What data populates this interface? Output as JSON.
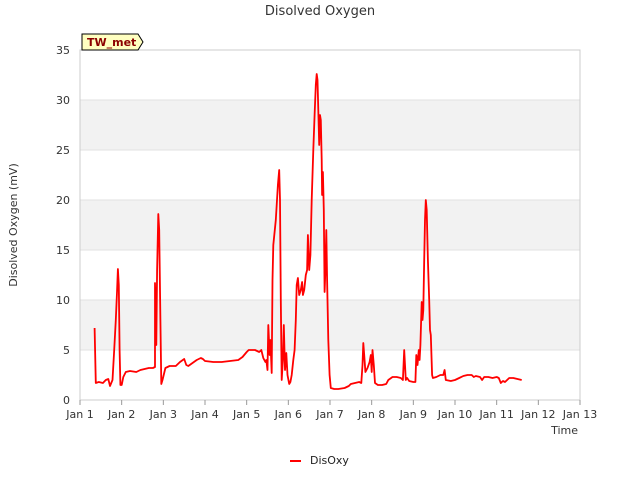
{
  "chart_data": {
    "type": "line",
    "title": "Disolved Oxygen",
    "xlabel": "Time",
    "ylabel": "Disolved Oxygen (mV)",
    "xlim": [
      "Jan 1",
      "Jan 13"
    ],
    "ylim": [
      0,
      35
    ],
    "x_ticks": [
      "Jan 1",
      "Jan 2",
      "Jan 3",
      "Jan 4",
      "Jan 5",
      "Jan 6",
      "Jan 7",
      "Jan 8",
      "Jan 9",
      "Jan 10",
      "Jan 11",
      "Jan 12",
      "Jan 13"
    ],
    "y_ticks": [
      0,
      5,
      10,
      15,
      20,
      25,
      30,
      35
    ],
    "grid": "horizontal bands",
    "legend_position": "bottom-center",
    "station_badge": "TW_met",
    "colors": {
      "series": "#ff0000",
      "band": "#f2f2f2",
      "badge_fill": "#ffffc0"
    },
    "series": [
      {
        "name": "DisOxy",
        "x_unit": "days since Jan 1",
        "points": [
          [
            0.35,
            7.2
          ],
          [
            0.38,
            1.7
          ],
          [
            0.45,
            1.8
          ],
          [
            0.55,
            1.7
          ],
          [
            0.62,
            2.0
          ],
          [
            0.68,
            2.1
          ],
          [
            0.72,
            1.4
          ],
          [
            0.78,
            2.0
          ],
          [
            0.82,
            5.0
          ],
          [
            0.86,
            8.0
          ],
          [
            0.89,
            11.0
          ],
          [
            0.91,
            13.1
          ],
          [
            0.93,
            11.5
          ],
          [
            0.95,
            5.0
          ],
          [
            0.97,
            1.5
          ],
          [
            1.0,
            1.5
          ],
          [
            1.04,
            2.3
          ],
          [
            1.1,
            2.8
          ],
          [
            1.2,
            2.9
          ],
          [
            1.35,
            2.8
          ],
          [
            1.45,
            3.0
          ],
          [
            1.55,
            3.1
          ],
          [
            1.65,
            3.2
          ],
          [
            1.75,
            3.2
          ],
          [
            1.8,
            3.3
          ],
          [
            1.8,
            11.7
          ],
          [
            1.83,
            5.5
          ],
          [
            1.85,
            13.0
          ],
          [
            1.88,
            18.6
          ],
          [
            1.9,
            17.0
          ],
          [
            1.93,
            8.0
          ],
          [
            1.95,
            1.6
          ],
          [
            1.98,
            2.0
          ],
          [
            2.05,
            3.2
          ],
          [
            2.15,
            3.4
          ],
          [
            2.3,
            3.4
          ],
          [
            2.4,
            3.8
          ],
          [
            2.5,
            4.1
          ],
          [
            2.55,
            3.5
          ],
          [
            2.6,
            3.4
          ],
          [
            2.7,
            3.7
          ],
          [
            2.8,
            4.0
          ],
          [
            2.9,
            4.2
          ],
          [
            2.95,
            4.1
          ],
          [
            3.0,
            3.9
          ],
          [
            3.2,
            3.8
          ],
          [
            3.4,
            3.8
          ],
          [
            3.6,
            3.9
          ],
          [
            3.8,
            4.0
          ],
          [
            3.9,
            4.3
          ],
          [
            4.0,
            4.8
          ],
          [
            4.05,
            5.0
          ],
          [
            4.2,
            5.0
          ],
          [
            4.3,
            4.8
          ],
          [
            4.35,
            5.0
          ],
          [
            4.4,
            4.2
          ],
          [
            4.45,
            3.8
          ],
          [
            4.47,
            4.0
          ],
          [
            4.5,
            3.0
          ],
          [
            4.52,
            7.5
          ],
          [
            4.55,
            4.5
          ],
          [
            4.57,
            6.0
          ],
          [
            4.6,
            2.7
          ],
          [
            4.62,
            12.0
          ],
          [
            4.64,
            15.5
          ],
          [
            4.7,
            18.0
          ],
          [
            4.75,
            21.5
          ],
          [
            4.78,
            23.0
          ],
          [
            4.8,
            20.0
          ],
          [
            4.82,
            10.0
          ],
          [
            4.84,
            2.0
          ],
          [
            4.87,
            4.0
          ],
          [
            4.89,
            7.5
          ],
          [
            4.92,
            3.0
          ],
          [
            4.95,
            4.7
          ],
          [
            4.98,
            2.5
          ],
          [
            5.02,
            1.6
          ],
          [
            5.05,
            1.8
          ],
          [
            5.08,
            2.5
          ],
          [
            5.12,
            4.0
          ],
          [
            5.15,
            5.0
          ],
          [
            5.18,
            8.0
          ],
          [
            5.2,
            11.5
          ],
          [
            5.23,
            12.2
          ],
          [
            5.26,
            10.5
          ],
          [
            5.3,
            11.0
          ],
          [
            5.33,
            11.8
          ],
          [
            5.35,
            10.5
          ],
          [
            5.38,
            11.0
          ],
          [
            5.42,
            12.5
          ],
          [
            5.45,
            13.0
          ],
          [
            5.47,
            16.5
          ],
          [
            5.5,
            13.0
          ],
          [
            5.53,
            14.5
          ],
          [
            5.56,
            20.0
          ],
          [
            5.6,
            25.0
          ],
          [
            5.63,
            28.5
          ],
          [
            5.66,
            31.5
          ],
          [
            5.68,
            32.6
          ],
          [
            5.7,
            32.0
          ],
          [
            5.72,
            29.0
          ],
          [
            5.74,
            25.5
          ],
          [
            5.76,
            28.5
          ],
          [
            5.78,
            28.0
          ],
          [
            5.8,
            24.0
          ],
          [
            5.81,
            20.5
          ],
          [
            5.83,
            22.8
          ],
          [
            5.85,
            19.0
          ],
          [
            5.87,
            10.8
          ],
          [
            5.89,
            13.0
          ],
          [
            5.91,
            17.0
          ],
          [
            5.93,
            12.0
          ],
          [
            5.96,
            6.0
          ],
          [
            5.99,
            2.5
          ],
          [
            6.02,
            1.2
          ],
          [
            6.1,
            1.1
          ],
          [
            6.2,
            1.1
          ],
          [
            6.35,
            1.2
          ],
          [
            6.45,
            1.4
          ],
          [
            6.5,
            1.6
          ],
          [
            6.6,
            1.7
          ],
          [
            6.7,
            1.8
          ],
          [
            6.75,
            1.7
          ],
          [
            6.78,
            3.5
          ],
          [
            6.8,
            5.7
          ],
          [
            6.82,
            4.5
          ],
          [
            6.85,
            2.8
          ],
          [
            6.9,
            3.2
          ],
          [
            6.95,
            3.8
          ],
          [
            6.98,
            4.5
          ],
          [
            7.0,
            2.8
          ],
          [
            7.02,
            5.0
          ],
          [
            7.05,
            3.5
          ],
          [
            7.08,
            1.7
          ],
          [
            7.15,
            1.5
          ],
          [
            7.25,
            1.5
          ],
          [
            7.35,
            1.6
          ],
          [
            7.4,
            2.0
          ],
          [
            7.5,
            2.3
          ],
          [
            7.6,
            2.3
          ],
          [
            7.7,
            2.2
          ],
          [
            7.75,
            2.0
          ],
          [
            7.78,
            5.0
          ],
          [
            7.8,
            3.5
          ],
          [
            7.82,
            2.0
          ],
          [
            7.85,
            2.2
          ],
          [
            7.9,
            1.9
          ],
          [
            8.0,
            1.8
          ],
          [
            8.05,
            1.8
          ],
          [
            8.07,
            4.5
          ],
          [
            8.1,
            3.5
          ],
          [
            8.13,
            5.0
          ],
          [
            8.15,
            4.0
          ],
          [
            8.17,
            5.5
          ],
          [
            8.2,
            9.8
          ],
          [
            8.22,
            8.0
          ],
          [
            8.24,
            9.0
          ],
          [
            8.26,
            14.0
          ],
          [
            8.28,
            18.0
          ],
          [
            8.3,
            20.0
          ],
          [
            8.32,
            19.0
          ],
          [
            8.35,
            14.0
          ],
          [
            8.38,
            10.0
          ],
          [
            8.4,
            7.0
          ],
          [
            8.42,
            6.5
          ],
          [
            8.45,
            2.5
          ],
          [
            8.47,
            2.2
          ],
          [
            8.55,
            2.3
          ],
          [
            8.65,
            2.5
          ],
          [
            8.72,
            2.5
          ],
          [
            8.75,
            3.0
          ],
          [
            8.78,
            2.0
          ],
          [
            8.9,
            1.9
          ],
          [
            9.0,
            2.0
          ],
          [
            9.1,
            2.2
          ],
          [
            9.2,
            2.4
          ],
          [
            9.3,
            2.5
          ],
          [
            9.4,
            2.5
          ],
          [
            9.45,
            2.3
          ],
          [
            9.5,
            2.4
          ],
          [
            9.6,
            2.3
          ],
          [
            9.65,
            2.0
          ],
          [
            9.7,
            2.3
          ],
          [
            9.8,
            2.3
          ],
          [
            9.9,
            2.2
          ],
          [
            10.0,
            2.3
          ],
          [
            10.05,
            2.2
          ],
          [
            10.1,
            1.7
          ],
          [
            10.15,
            1.9
          ],
          [
            10.2,
            1.8
          ],
          [
            10.25,
            2.0
          ],
          [
            10.3,
            2.2
          ],
          [
            10.4,
            2.2
          ],
          [
            10.5,
            2.1
          ],
          [
            10.6,
            2.0
          ]
        ]
      }
    ]
  }
}
